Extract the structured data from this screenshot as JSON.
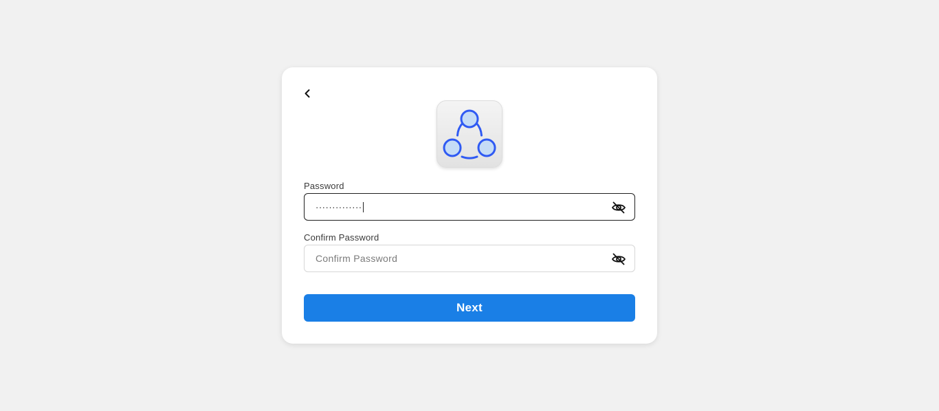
{
  "icons": {
    "back": "chevron-left-icon",
    "logo": "three-circles-network-icon",
    "password_toggle": "eye-off-icon",
    "confirm_toggle": "eye-off-icon"
  },
  "colors": {
    "background": "#f1f1f1",
    "card": "#ffffff",
    "accent": "#1a7fe6",
    "logo_blue": "#2f5af3"
  },
  "form": {
    "password": {
      "label": "Password",
      "value": "··············"
    },
    "confirm_password": {
      "label": "Confirm Password",
      "value": "",
      "placeholder": "Confirm Password"
    },
    "next_label": "Next"
  }
}
